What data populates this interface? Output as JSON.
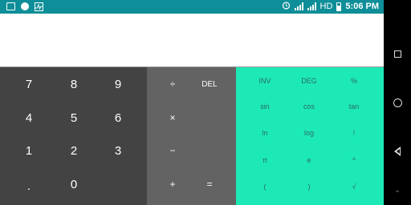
{
  "status_bar": {
    "left_icons": [
      "image-icon",
      "circle-icon",
      "activity-icon"
    ],
    "right": {
      "alarm_icon": "alarm-icon",
      "network_label": "HD",
      "time": "5:06 PM"
    },
    "color": "#0e8e98"
  },
  "display": {
    "expression": "",
    "result": ""
  },
  "numpad": {
    "keys": [
      "7",
      "8",
      "9",
      "4",
      "5",
      "6",
      "1",
      "2",
      "3",
      ".",
      "0"
    ]
  },
  "operators": {
    "divide": "÷",
    "delete": "DEL",
    "multiply": "×",
    "minus": "−",
    "plus": "+",
    "equals": "="
  },
  "advanced": {
    "keys": [
      "INV",
      "DEG",
      "%",
      "sin",
      "cos",
      "tan",
      "ln",
      "log",
      "!",
      "π",
      "e",
      "^",
      "(",
      ")",
      "√"
    ],
    "color": "#1de9b6"
  },
  "nav": {
    "recents_icon": "square-icon",
    "home_icon": "circle-icon",
    "back_icon": "triangle-back-icon",
    "chevron": "⌄"
  }
}
